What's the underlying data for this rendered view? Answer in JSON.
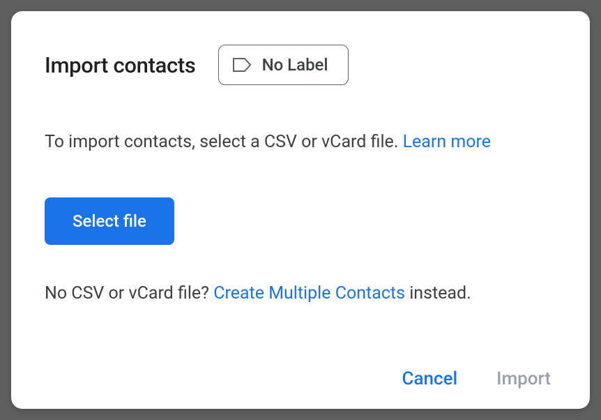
{
  "dialog": {
    "title": "Import contacts",
    "label_button": "No Label",
    "instruction_prefix": "To import contacts, select a CSV or vCard file. ",
    "learn_more": "Learn more",
    "select_file": "Select file",
    "no_file_prefix": "No CSV or vCard file? ",
    "create_multiple": "Create Multiple Contacts",
    "no_file_suffix": " instead.",
    "cancel": "Cancel",
    "import": "Import"
  }
}
